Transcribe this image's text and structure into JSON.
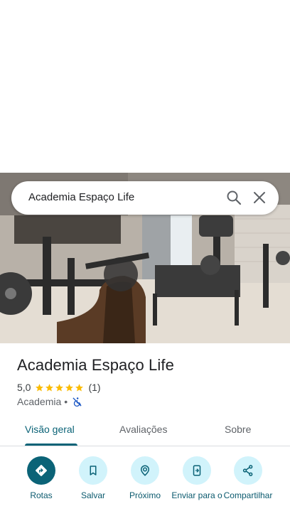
{
  "search": {
    "query": "Academia Espaço Life"
  },
  "place": {
    "name": "Academia Espaço Life",
    "rating": "5,0",
    "stars": 5,
    "review_count": "(1)",
    "category": "Academia",
    "separator": "•"
  },
  "tabs": [
    {
      "label": "Visão geral",
      "active": true
    },
    {
      "label": "Avaliações",
      "active": false
    },
    {
      "label": "Sobre",
      "active": false
    }
  ],
  "actions": [
    {
      "label": "Rotas",
      "icon": "directions-icon"
    },
    {
      "label": "Salvar",
      "icon": "bookmark-icon"
    },
    {
      "label": "Próximo",
      "icon": "nearby-icon"
    },
    {
      "label": "Enviar para o",
      "icon": "send-to-phone-icon"
    },
    {
      "label": "Compartilhar",
      "icon": "share-icon"
    }
  ],
  "colors": {
    "accent": "#0b6377",
    "action_bg": "#d1f3fb",
    "star": "#fbbc04"
  }
}
